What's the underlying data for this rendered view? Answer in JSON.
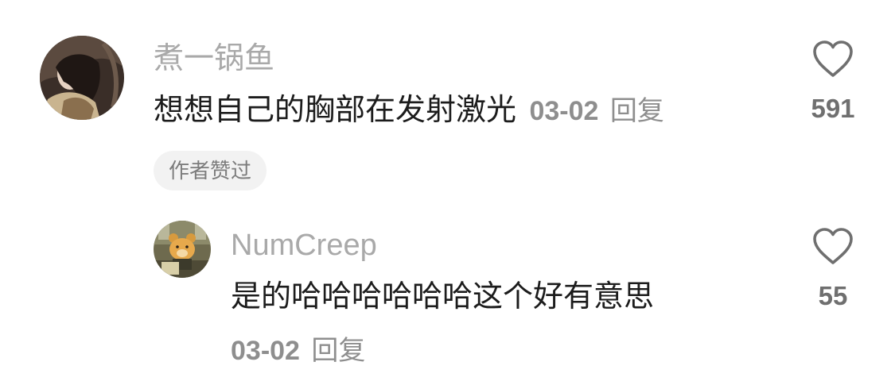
{
  "comments": [
    {
      "username": "煮一锅鱼",
      "text": "想想自己的胸部在发射激光",
      "date": "03-02",
      "reply_label": "回复",
      "likes": "591",
      "badge": "作者赞过",
      "avatar": "woman-portrait-avatar"
    }
  ],
  "replies": [
    {
      "username": "NumCreep",
      "text": "是的哈哈哈哈哈哈这个好有意思",
      "date": "03-02",
      "reply_label": "回复",
      "likes": "55",
      "avatar": "bear-at-desk-avatar"
    }
  ],
  "colors": {
    "username": "#a9a9a9",
    "text": "#1c1c1c",
    "meta": "#8e8e8e",
    "badge_bg": "#f2f2f2",
    "icon": "#6f6f6f"
  }
}
